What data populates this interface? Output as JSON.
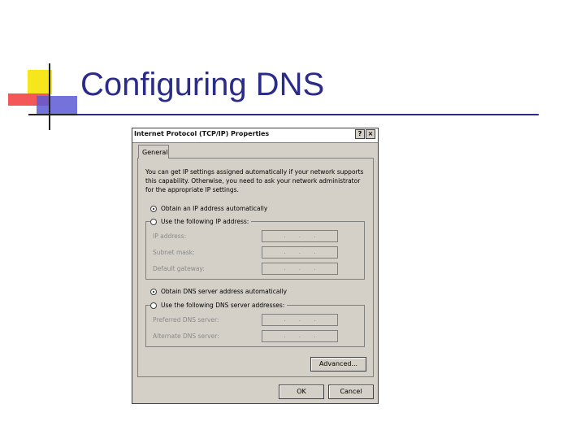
{
  "slide": {
    "title": "Configuring DNS"
  },
  "dialog": {
    "title": "Internet Protocol (TCP/IP) Properties",
    "help_label": "?",
    "close_label": "×",
    "tab_general": "General",
    "description": "You can get IP settings assigned automatically if your network supports this capability. Otherwise, you need to ask your network administrator for the appropriate IP settings.",
    "ip_auto_label": "Obtain an IP address automatically",
    "ip_manual_label": "Use the following IP address:",
    "ip_address_label": "IP address:",
    "subnet_label": "Subnet mask:",
    "gateway_label": "Default gateway:",
    "dns_auto_label": "Obtain DNS server address automatically",
    "dns_manual_label": "Use the following DNS server addresses:",
    "preferred_dns_label": "Preferred DNS server:",
    "alternate_dns_label": "Alternate DNS server:",
    "ip_placeholder": ". . .",
    "advanced_label": "Advanced...",
    "ok_label": "OK",
    "cancel_label": "Cancel"
  },
  "colors": {
    "title": "#2b2b88",
    "accent_yellow": "#f7e400",
    "accent_red": "#ee3333",
    "accent_blue": "#3333cc"
  }
}
